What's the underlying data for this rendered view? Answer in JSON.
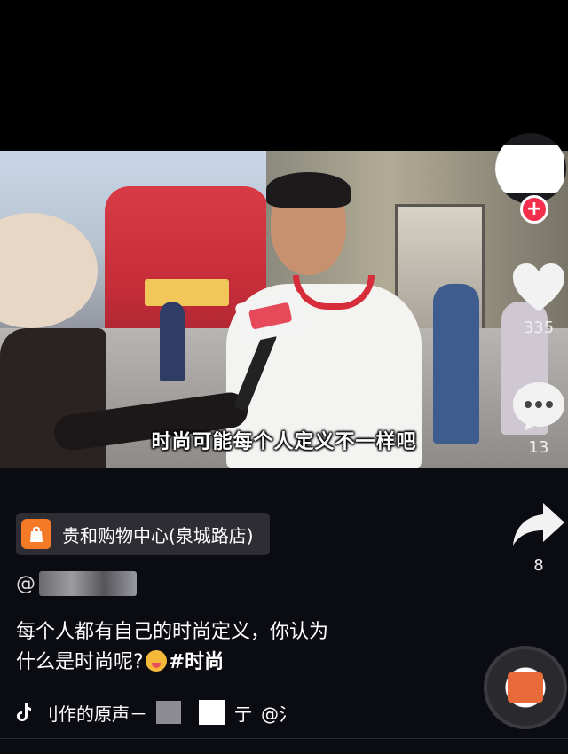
{
  "video": {
    "subtitle": "时尚可能每个人定义不一样吧"
  },
  "rail": {
    "follow_symbol": "+",
    "likes": "335",
    "comments": "13",
    "shares": "8",
    "icons": [
      "avatar",
      "heart-icon",
      "comment-icon",
      "share-icon"
    ]
  },
  "shop": {
    "label": "贵和购物中心(泉城路店)",
    "icon": "shopping-bag-icon",
    "accent": "#f47a27"
  },
  "author": {
    "prefix": "@"
  },
  "caption": {
    "line1": "每个人都有自己的时尚定义，你认为",
    "line2": "什么是时尚呢?",
    "hashtag": "#时尚"
  },
  "music": {
    "icon": "tiktok-note-icon",
    "text_a": "刂作的原声－",
    "text_b": "亍",
    "text_c": "@氵"
  },
  "colors": {
    "follow_badge": "#f42f4d",
    "background": "#0b0b12"
  }
}
